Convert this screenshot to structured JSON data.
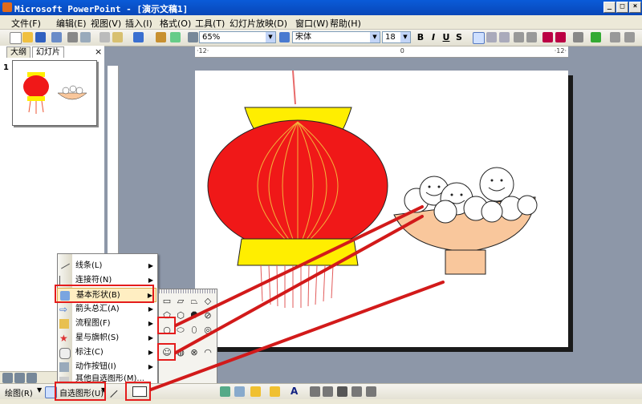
{
  "window": {
    "title": "Microsoft PowerPoint - [演示文稿1]",
    "controls": [
      "_",
      "□",
      "×"
    ]
  },
  "menu": {
    "items": [
      "文件(F)",
      "编辑(E)",
      "视图(V)",
      "插入(I)",
      "格式(O)",
      "工具(T)",
      "幻灯片放映(D)",
      "窗口(W)",
      "帮助(H)"
    ]
  },
  "toolbar": {
    "zoom": "65%",
    "font": "宋体",
    "font_size": "18",
    "bold": "B",
    "italic": "I",
    "underline": "U",
    "shadow": "S"
  },
  "left_pane": {
    "tabs": [
      "大纲",
      "幻灯片"
    ],
    "slide_number": "1"
  },
  "ruler": {
    "h_left": "·12·",
    "h_right": "·12·"
  },
  "autoshape_menu": {
    "items": [
      {
        "label": "线条(L)",
        "icon": "line-icon"
      },
      {
        "label": "连接符(N)",
        "icon": "connector-icon"
      },
      {
        "label": "基本形状(B)",
        "icon": "basic-shapes-icon"
      },
      {
        "label": "箭头总汇(A)",
        "icon": "arrow-icon"
      },
      {
        "label": "流程图(F)",
        "icon": "flowchart-icon"
      },
      {
        "label": "星与旗帜(S)",
        "icon": "star-icon"
      },
      {
        "label": "标注(C)",
        "icon": "callout-icon"
      },
      {
        "label": "动作按钮(I)",
        "icon": "action-button-icon"
      },
      {
        "label": "其他自选图形(M)...",
        "icon": "more-shapes-icon"
      }
    ]
  },
  "basic_shapes": [
    "▭",
    "▱",
    "⏢",
    "◇",
    "⬠",
    "⬡",
    "⯃",
    "○",
    "⬭",
    "⬯",
    "◎",
    "⊘",
    "☺",
    "◍",
    "⊗",
    "◠",
    "(",
    ")",
    "{",
    "}"
  ],
  "drawing_bar": {
    "draw": "绘图(R)",
    "autoshapes": "自选图形(U)"
  },
  "colors": {
    "lantern_red": "#f01818",
    "lantern_yellow": "#ffee00",
    "bowl": "#f9c79c",
    "highlight": "#e41c1c"
  }
}
